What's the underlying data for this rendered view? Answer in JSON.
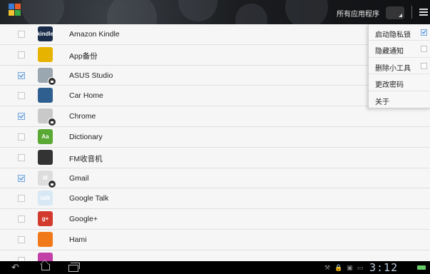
{
  "actionbar": {
    "title": "所有应用程序"
  },
  "apps": [
    {
      "name": "Amazon Kindle",
      "checked": false,
      "icon": "kindle-icon",
      "icon_text": "kindle",
      "color": "#1a2d4a",
      "locked": false
    },
    {
      "name": "App备份",
      "checked": false,
      "icon": "app-backup-icon",
      "icon_text": "",
      "color": "#e6b400",
      "locked": false
    },
    {
      "name": "ASUS Studio",
      "checked": true,
      "icon": "asus-studio-icon",
      "icon_text": "",
      "color": "#9aa6b0",
      "locked": true
    },
    {
      "name": "Car Home",
      "checked": false,
      "icon": "car-home-icon",
      "icon_text": "",
      "color": "#2e5f8f",
      "locked": false
    },
    {
      "name": "Chrome",
      "checked": true,
      "icon": "chrome-icon",
      "icon_text": "",
      "color": "#c9c9c9",
      "locked": true
    },
    {
      "name": "Dictionary",
      "checked": false,
      "icon": "dictionary-icon",
      "icon_text": "Aa",
      "color": "#5aa935",
      "locked": false
    },
    {
      "name": "FM收音机",
      "checked": false,
      "icon": "fm-radio-icon",
      "icon_text": "",
      "color": "#333333",
      "locked": false
    },
    {
      "name": "Gmail",
      "checked": true,
      "icon": "gmail-icon",
      "icon_text": "M",
      "color": "#dddddd",
      "locked": true
    },
    {
      "name": "Google Talk",
      "checked": false,
      "icon": "google-talk-icon",
      "icon_text": "talk",
      "color": "#d8e8f4",
      "locked": false
    },
    {
      "name": "Google+",
      "checked": false,
      "icon": "google-plus-icon",
      "icon_text": "g+",
      "color": "#d23a2d",
      "locked": false
    },
    {
      "name": "Hami",
      "checked": false,
      "icon": "hami-icon",
      "icon_text": "",
      "color": "#f07a1a",
      "locked": false
    },
    {
      "name": "",
      "checked": false,
      "icon": "partial-app-icon",
      "icon_text": "",
      "color": "#c13fa6",
      "locked": false
    }
  ],
  "menu": {
    "items": [
      {
        "label": "启动隐私锁",
        "checkbox": true,
        "checked": true
      },
      {
        "label": "隐藏通知",
        "checkbox": true,
        "checked": false
      },
      {
        "label": "删除小工具",
        "checkbox": true,
        "checked": false
      },
      {
        "label": "更改密码",
        "checkbox": false,
        "checked": false
      },
      {
        "label": "关于",
        "checkbox": false,
        "checked": false
      }
    ]
  },
  "statusbar": {
    "time": "3:12",
    "icons": [
      "wrench-icon",
      "lock-icon",
      "signal-icon",
      "image-icon",
      "wifi-icon",
      "battery-icon"
    ]
  },
  "nav": {
    "buttons": [
      "back-icon",
      "home-icon",
      "recent-apps-icon"
    ]
  }
}
